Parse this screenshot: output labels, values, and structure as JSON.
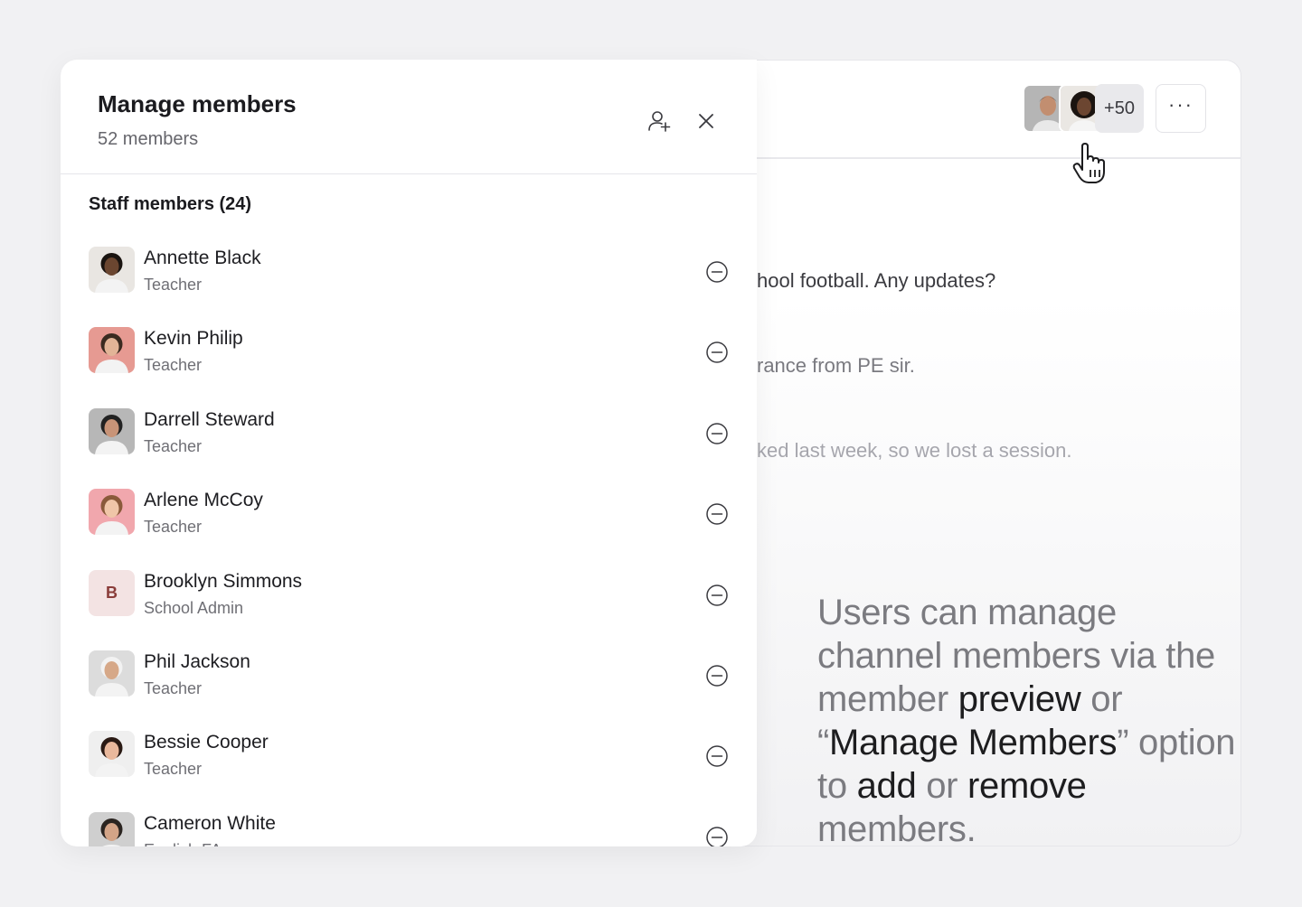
{
  "header": {
    "member_stack_more": "+50",
    "more_label": "···"
  },
  "messages": [
    "hool football. Any updates?",
    "rance from PE sir.",
    "ked last week, so we lost a session."
  ],
  "panel": {
    "title": "Manage members",
    "subtitle": "52 members",
    "add_member_icon": "add-user-icon",
    "close_icon": "close-icon"
  },
  "section": {
    "title": "Staff members (24)"
  },
  "members": [
    {
      "name": "Annette Black",
      "role": "Teacher",
      "avatar": "photo",
      "avatar_bg": "#e9e6e2",
      "skin": "#6b4630",
      "hair": "#1a1410"
    },
    {
      "name": "Kevin Philip",
      "role": "Teacher",
      "avatar": "photo",
      "avatar_bg": "#e69a92",
      "skin": "#e2b497",
      "hair": "#3a2a20"
    },
    {
      "name": "Darrell Steward",
      "role": "Teacher",
      "avatar": "photo",
      "avatar_bg": "#b7b7b7",
      "skin": "#c89478",
      "hair": "#222"
    },
    {
      "name": "Arlene McCoy",
      "role": "Teacher",
      "avatar": "photo",
      "avatar_bg": "#f1a7ad",
      "skin": "#f0c6a8",
      "hair": "#8a5a3a"
    },
    {
      "name": "Brooklyn Simmons",
      "role": "School Admin",
      "avatar": "initial",
      "initial": "B"
    },
    {
      "name": "Phil Jackson",
      "role": "Teacher",
      "avatar": "photo",
      "avatar_bg": "#dcdcdc",
      "skin": "#d6a888",
      "hair": "#f2f2f2"
    },
    {
      "name": "Bessie Cooper",
      "role": "Teacher",
      "avatar": "photo",
      "avatar_bg": "#efefef",
      "skin": "#e9b89c",
      "hair": "#2a1a14"
    },
    {
      "name": "Cameron White",
      "role": "English FA",
      "avatar": "photo",
      "avatar_bg": "#cfcfcf",
      "skin": "#d3a487",
      "hair": "#2a2420"
    }
  ],
  "caption": {
    "p1": "Users can manage channel members via the member ",
    "preview": "preview",
    "p2": " or “",
    "manage_members": "Manage Members",
    "p3": "” option to ",
    "add": "add",
    "p4": " or ",
    "remove": "remove",
    "p5": " members."
  },
  "colors": {
    "background": "#f1f1f3",
    "panel": "#ffffff",
    "accent_text": "#1d1d1f",
    "muted_text": "#7b7b80"
  }
}
